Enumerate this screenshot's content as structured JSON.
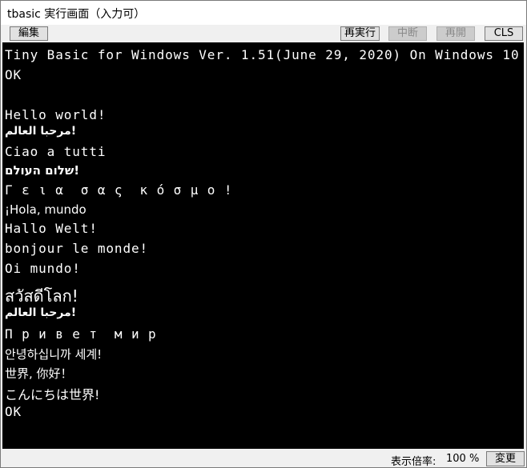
{
  "window": {
    "title": "tbasic 実行画面（入力可）"
  },
  "toolbar": {
    "edit_label": "編集",
    "rerun_label": "再実行",
    "pause_label": "中断",
    "resume_label": "再開",
    "cls_label": "CLS"
  },
  "console": {
    "lines": [
      "Tiny Basic for Windows Ver. 1.51(June 29, 2020) On Windows 10",
      "OK",
      "",
      "Hello world!",
      "!مرحبا العالم",
      "Ciao a tutti",
      "!שלום העולם",
      "Γ ε ι α  σ α ς  κ ό σ μ ο !",
      "¡Hola, mundo",
      "Hallo Welt!",
      "bonjour le monde!",
      "Oi mundo!",
      "สวัสดีโลก!",
      "!مرحبا العالم",
      "П р и в е т  м и р",
      "안녕하십니까 세계!",
      "世界, 你好！",
      "こんにちは世界!",
      "OK"
    ]
  },
  "statusbar": {
    "zoom_label": "表示倍率:",
    "zoom_value": "100 %",
    "change_label": "変更"
  }
}
